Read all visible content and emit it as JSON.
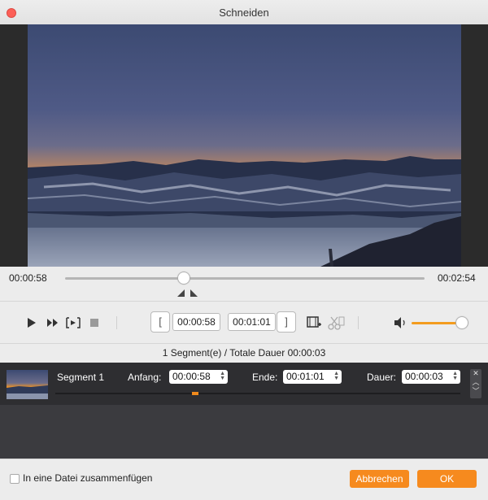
{
  "window": {
    "title": "Schneiden"
  },
  "seek": {
    "current_time": "00:00:58",
    "total_time": "00:02:54",
    "position_fraction": 0.33
  },
  "trim": {
    "start_time": "00:00:58",
    "end_time": "00:01:01"
  },
  "volume": {
    "level_fraction": 0.9
  },
  "summary": {
    "text": "1 Segment(e) / Totale Dauer 00:00:03"
  },
  "segments": [
    {
      "name": "Segment 1",
      "start_label": "Anfang:",
      "start_value": "00:00:58",
      "end_label": "Ende:",
      "end_value": "00:01:01",
      "duration_label": "Dauer:",
      "duration_value": "00:00:03"
    }
  ],
  "merge": {
    "label": "In eine Datei zusammenfügen",
    "checked": false
  },
  "buttons": {
    "cancel": "Abbrechen",
    "ok": "OK"
  },
  "icons": {
    "play": "play-icon",
    "fast_forward": "fast-forward-icon",
    "clip": "clip-icon",
    "stop": "stop-icon",
    "set_start": "bracket-left-icon",
    "set_end": "bracket-right-icon",
    "add_segment": "film-add-icon",
    "cut": "scissors-icon",
    "volume": "speaker-icon"
  },
  "colors": {
    "accent": "#f68a1e",
    "close": "#fc5f57",
    "segment_bg": "#2e2e31"
  }
}
